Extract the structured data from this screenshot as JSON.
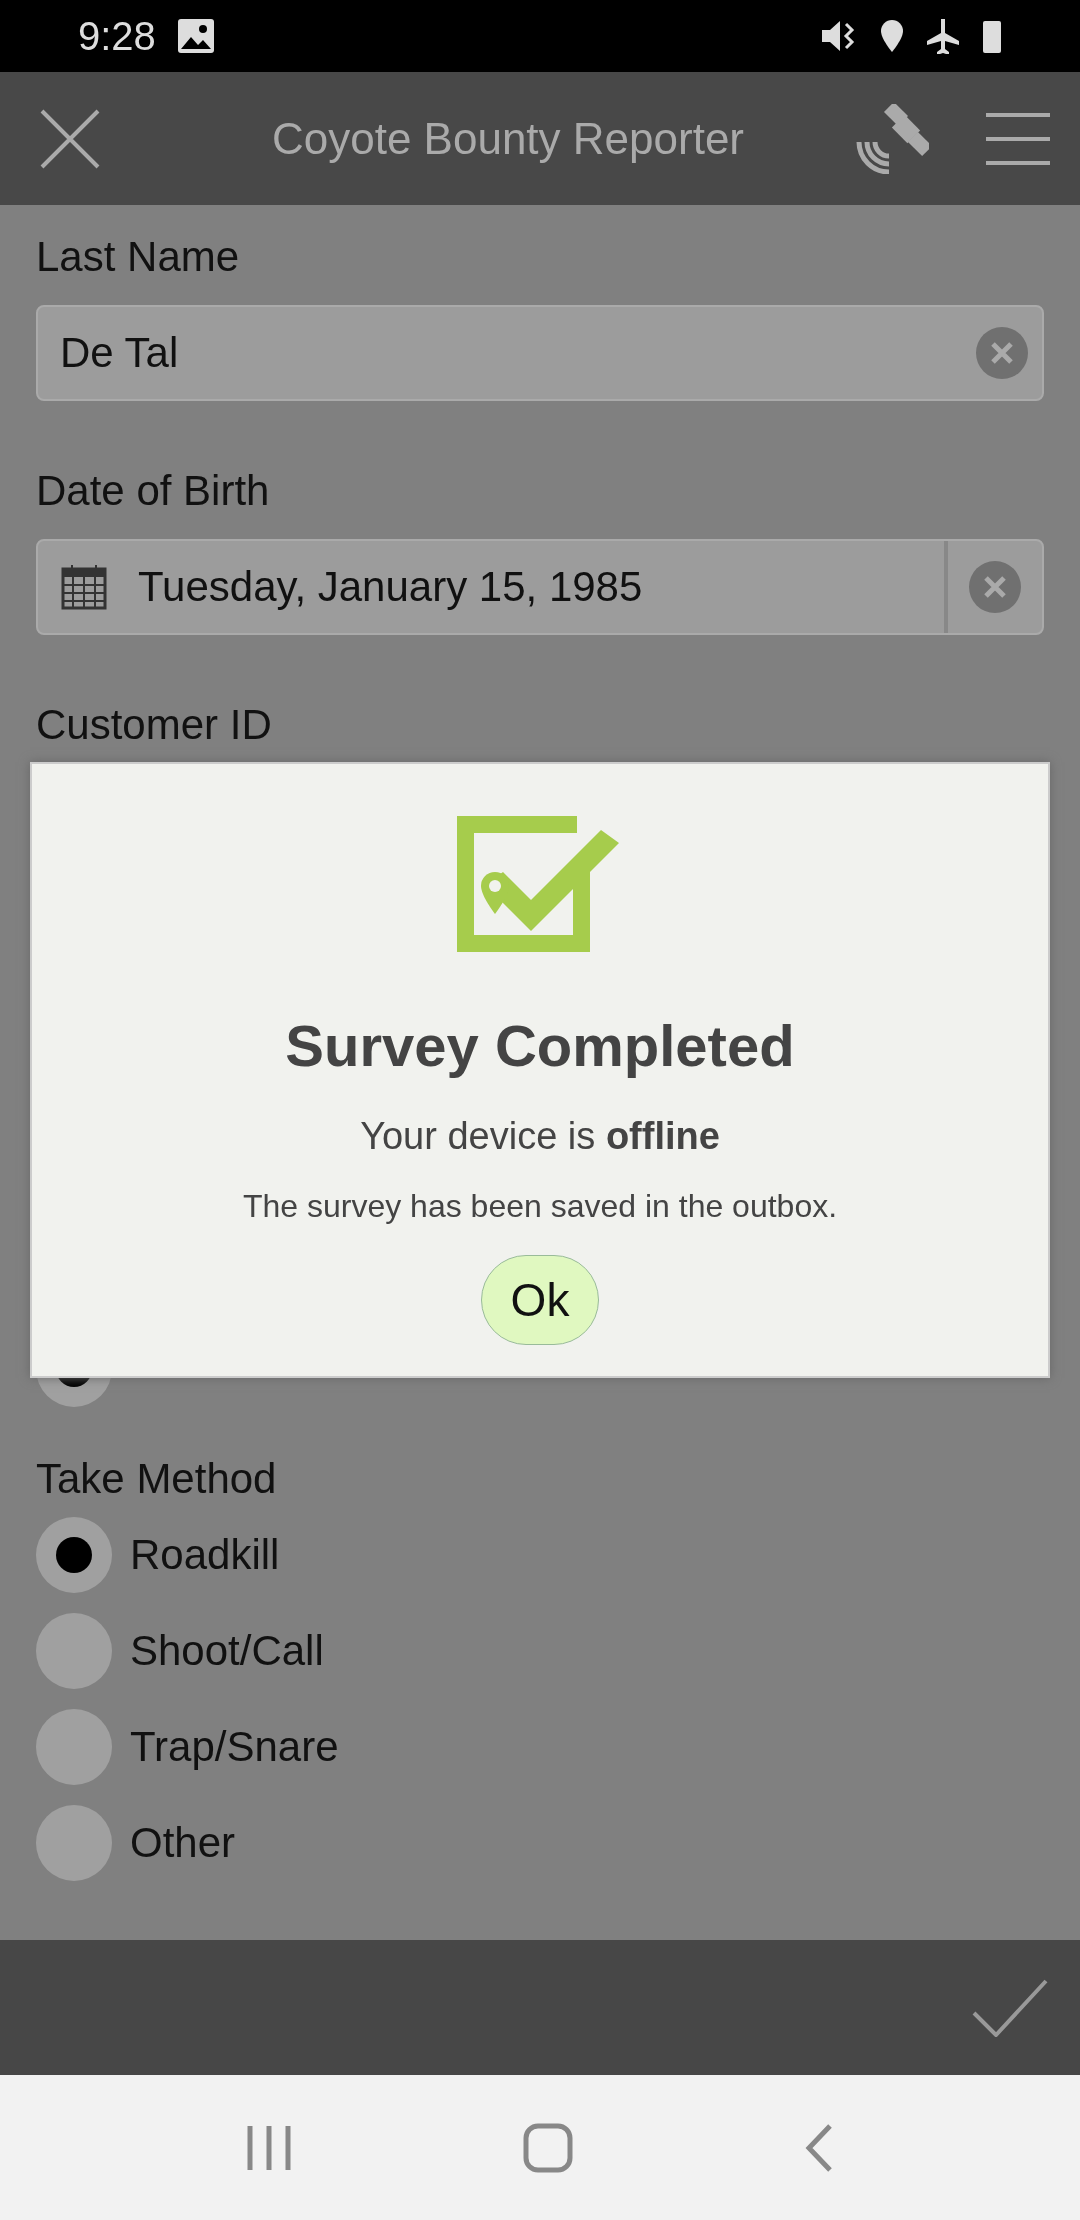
{
  "status_bar": {
    "time": "9:28"
  },
  "app_bar": {
    "title": "Coyote Bounty Reporter"
  },
  "fields": [
    {
      "kind": "text",
      "label": "Last Name",
      "value": "De Tal"
    },
    {
      "kind": "date",
      "label": "Date of Birth",
      "value": "Tuesday, January 15, 1985"
    },
    {
      "kind": "label",
      "label": "Customer ID"
    }
  ],
  "hidden_option": {
    "selected": true
  },
  "take_method": {
    "label": "Take Method",
    "options": [
      {
        "label": "Roadkill",
        "selected": true
      },
      {
        "label": "Shoot/Call",
        "selected": false
      },
      {
        "label": "Trap/Snare",
        "selected": false
      },
      {
        "label": "Other",
        "selected": false
      }
    ]
  },
  "dialog": {
    "title": "Survey Completed",
    "status": "Your device is **offline**",
    "message": "The survey has been saved in the outbox.",
    "button": "Ok"
  }
}
